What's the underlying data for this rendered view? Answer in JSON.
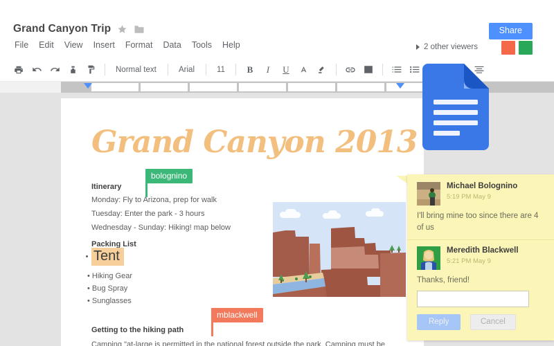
{
  "header": {
    "doc_title": "Grand Canyon Trip",
    "star_icon": "star-icon",
    "folder_icon": "folder-icon",
    "menus": [
      "File",
      "Edit",
      "View",
      "Insert",
      "Format",
      "Data",
      "Tools",
      "Help"
    ],
    "share_label": "Share",
    "viewers_label": "2 other viewers",
    "avatar_colors": [
      "#f4694a",
      "#2aa85a"
    ],
    "share_color": "#4d90fe"
  },
  "toolbar": {
    "icons": [
      "print-icon",
      "undo-icon",
      "redo-icon",
      "paint-format-icon",
      "paint-brush-icon"
    ],
    "style_label": "Normal text",
    "font_label": "Arial",
    "size_label": "11",
    "bold_label": "B",
    "italic_label": "I",
    "underline_label": "U",
    "text_color_label": "A",
    "highlight_icon": "highlight-icon",
    "link_icon": "link-icon",
    "image_icon": "image-icon",
    "numbered_list_icon": "numbered-list-icon",
    "bulleted_list_icon": "bulleted-list-icon",
    "indent_icon": "indent-icon",
    "align_left_icon": "align-left-icon",
    "align_center_icon": "align-center-icon"
  },
  "ruler": {
    "marker_color": "#4d90fe",
    "left_marker_label": "left-indent-marker",
    "right_marker_label": "right-indent-marker"
  },
  "document": {
    "title": "Grand Canyon 2013",
    "title_color": "#f2bf7f",
    "itinerary_heading": "Itinerary",
    "itinerary_lines": [
      "Monday: Fly to Arizona, prep for walk",
      "Tuesday: Enter the park - 3 hours",
      "Wednesday - Sunday: Hiking!  map below"
    ],
    "packing_heading": "Packing List",
    "packing_highlight": "Tent",
    "packing_highlight_color": "#f7cf9a",
    "packing_items": [
      "Hiking Gear",
      "Bug Spray",
      "Sunglasses"
    ],
    "hiking_heading": "Getting to the hiking path",
    "hiking_paragraph": "Camping \"at-large is permitted in  the national forest outside the park. Camping must be",
    "image_alt": "grand-canyon-illustration"
  },
  "collaborators": [
    {
      "name": "bolognino",
      "color": "#3bb878"
    },
    {
      "name": "mblackwell",
      "color": "#f2795c"
    }
  ],
  "comments": {
    "items": [
      {
        "author": "Michael Bolognino",
        "time": "5:19 PM May 9",
        "text": "I'll bring mine too since there are 4 of us",
        "avatar": "michael-bolognino-avatar"
      },
      {
        "author": "Meredith Blackwell",
        "time": "5:21 PM May 9",
        "text": "Thanks, friend!",
        "avatar": "meredith-blackwell-avatar"
      }
    ],
    "reply_value": "",
    "reply_placeholder": "",
    "reply_label": "Reply",
    "cancel_label": "Cancel",
    "card_color": "#fbf5b7"
  },
  "logo": {
    "name": "google-docs-logo",
    "color": "#3b78e7"
  }
}
